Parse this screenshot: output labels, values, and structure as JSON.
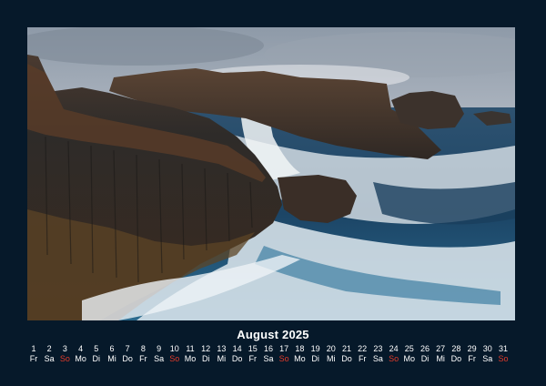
{
  "calendar": {
    "title": "August 2025",
    "sunday_color": "#e03a2a",
    "days": [
      {
        "num": "1",
        "wd": "Fr"
      },
      {
        "num": "2",
        "wd": "Sa"
      },
      {
        "num": "3",
        "wd": "So"
      },
      {
        "num": "4",
        "wd": "Mo"
      },
      {
        "num": "5",
        "wd": "Di"
      },
      {
        "num": "6",
        "wd": "Mi"
      },
      {
        "num": "7",
        "wd": "Do"
      },
      {
        "num": "8",
        "wd": "Fr"
      },
      {
        "num": "9",
        "wd": "Sa"
      },
      {
        "num": "10",
        "wd": "So"
      },
      {
        "num": "11",
        "wd": "Mo"
      },
      {
        "num": "12",
        "wd": "Di"
      },
      {
        "num": "13",
        "wd": "Mi"
      },
      {
        "num": "14",
        "wd": "Do"
      },
      {
        "num": "15",
        "wd": "Fr"
      },
      {
        "num": "16",
        "wd": "Sa"
      },
      {
        "num": "17",
        "wd": "So"
      },
      {
        "num": "18",
        "wd": "Mo"
      },
      {
        "num": "19",
        "wd": "Di"
      },
      {
        "num": "20",
        "wd": "Mi"
      },
      {
        "num": "21",
        "wd": "Do"
      },
      {
        "num": "22",
        "wd": "Fr"
      },
      {
        "num": "23",
        "wd": "Sa"
      },
      {
        "num": "24",
        "wd": "So"
      },
      {
        "num": "25",
        "wd": "Mo"
      },
      {
        "num": "26",
        "wd": "Di"
      },
      {
        "num": "27",
        "wd": "Mi"
      },
      {
        "num": "28",
        "wd": "Do"
      },
      {
        "num": "29",
        "wd": "Fr"
      },
      {
        "num": "30",
        "wd": "Sa"
      },
      {
        "num": "31",
        "wd": "So"
      }
    ]
  }
}
